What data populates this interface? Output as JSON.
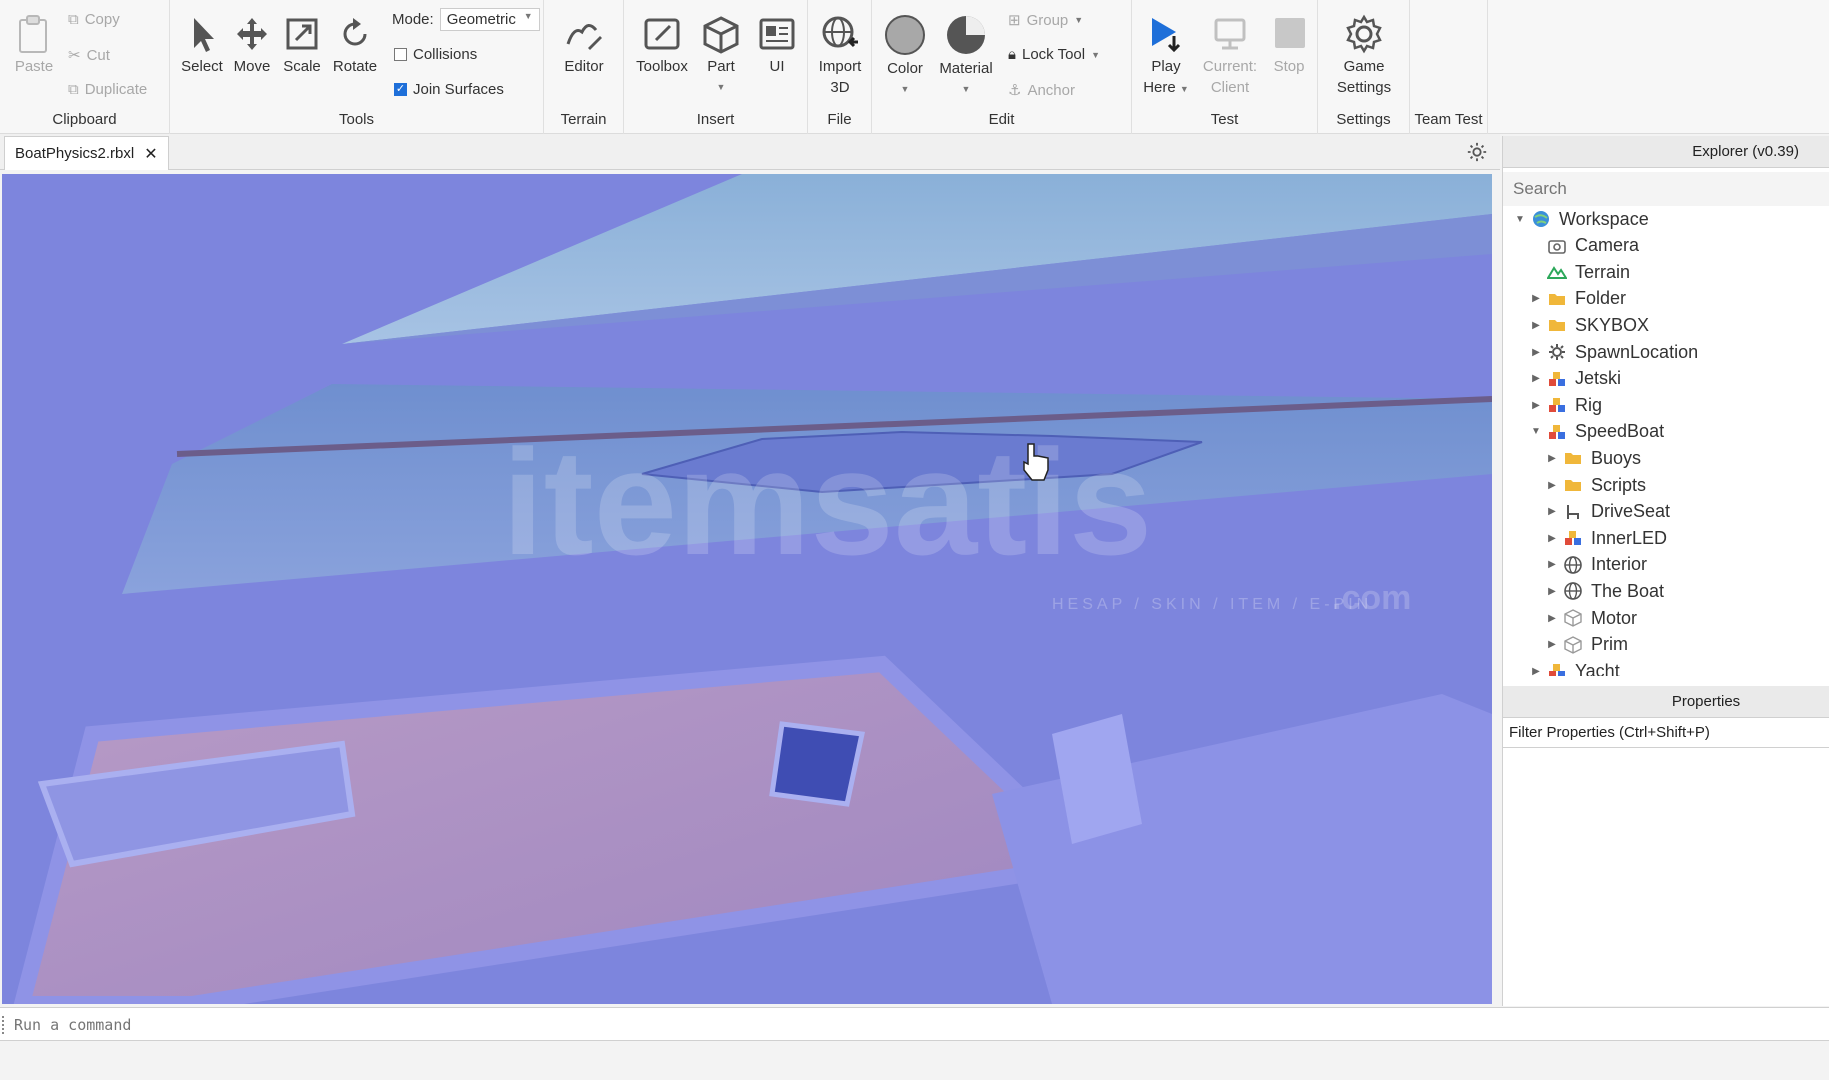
{
  "ribbon": {
    "clipboard": {
      "label": "Clipboard",
      "paste": "Paste",
      "copy": "Copy",
      "cut": "Cut",
      "duplicate": "Duplicate"
    },
    "tools": {
      "label": "Tools",
      "select": "Select",
      "move": "Move",
      "scale": "Scale",
      "rotate": "Rotate",
      "mode_label": "Mode:",
      "mode_value": "Geometric",
      "collisions": "Collisions",
      "collisions_checked": false,
      "join_surfaces": "Join Surfaces",
      "join_surfaces_checked": true
    },
    "terrain": {
      "label": "Terrain",
      "editor": "Editor"
    },
    "insert": {
      "label": "Insert",
      "toolbox": "Toolbox",
      "part": "Part",
      "ui": "UI"
    },
    "file": {
      "label": "File",
      "import_line1": "Import",
      "import_line2": "3D"
    },
    "edit": {
      "label": "Edit",
      "color": "Color",
      "material": "Material",
      "group": "Group",
      "lock_tool": "Lock Tool",
      "anchor": "Anchor"
    },
    "test": {
      "label": "Test",
      "play_line1": "Play",
      "play_line2": "Here",
      "current_line1": "Current:",
      "current_line2": "Client",
      "stop": "Stop"
    },
    "settings": {
      "label": "Settings",
      "game_line1": "Game",
      "game_line2": "Settings"
    },
    "team_test": {
      "label": "Team Test"
    }
  },
  "tabs": [
    {
      "label": "BoatPhysics2.rbxl"
    }
  ],
  "command_bar": {
    "placeholder": "Run a command"
  },
  "explorer": {
    "title": "Explorer (v0.39)",
    "search_placeholder": "Search",
    "items": [
      {
        "label": "Workspace",
        "icon": "globe-icon"
      },
      {
        "label": "Camera",
        "icon": "camera-icon"
      },
      {
        "label": "Terrain",
        "icon": "terrain-icon"
      },
      {
        "label": "Folder",
        "icon": "folder-icon"
      },
      {
        "label": "SKYBOX",
        "icon": "folder-icon"
      },
      {
        "label": "SpawnLocation",
        "icon": "spawn-icon"
      },
      {
        "label": "Jetski",
        "icon": "model-icon"
      },
      {
        "label": "Rig",
        "icon": "model-icon"
      },
      {
        "label": "SpeedBoat",
        "icon": "model-icon"
      },
      {
        "label": "Buoys",
        "icon": "folder-icon"
      },
      {
        "label": "Scripts",
        "icon": "folder-icon"
      },
      {
        "label": "DriveSeat",
        "icon": "seat-icon"
      },
      {
        "label": "InnerLED",
        "icon": "model-icon"
      },
      {
        "label": "Interior",
        "icon": "mesh-icon"
      },
      {
        "label": "The Boat",
        "icon": "mesh-icon"
      },
      {
        "label": "Motor",
        "icon": "part-icon"
      },
      {
        "label": "Prim",
        "icon": "part-icon"
      },
      {
        "label": "Yacht",
        "icon": "model-icon"
      }
    ]
  },
  "properties": {
    "title": "Properties",
    "filter_label": "Filter Properties (Ctrl+Shift+P)"
  },
  "watermark": {
    "brand": "itemsatis",
    "suffix": ".com",
    "tagline": "HESAP / SKIN / ITEM / E-PIN"
  },
  "colors": {
    "viewport_tint": "#7f86de",
    "accent_blue": "#1e6fd9"
  }
}
